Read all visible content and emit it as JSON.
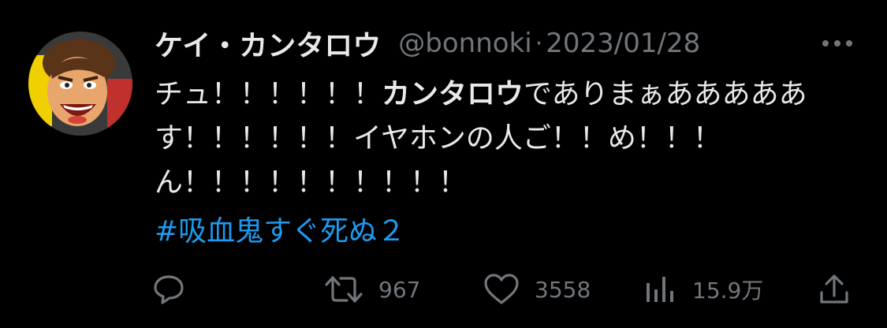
{
  "tweet": {
    "author": {
      "display_name": "ケイ・カンタロウ",
      "handle": "@bonnoki",
      "avatar_icon": "avatar-anime-man"
    },
    "separator": "·",
    "date": "2023/01/28",
    "more_icon": "more-horizontal-icon",
    "body": {
      "line1_a": "チュ！！！！！！",
      "line1_bold": "カンタロウ",
      "line1_b": "でありまぁあああああ",
      "line2": "す！！！！！！イヤホンの人ご！！め！！！",
      "line3": "ん！！！！！！！！！！"
    },
    "hashtag": "#吸血鬼すぐ死ぬ２",
    "actions": {
      "reply": {
        "icon": "reply-icon",
        "count": ""
      },
      "retweet": {
        "icon": "retweet-icon",
        "count": "967"
      },
      "like": {
        "icon": "heart-icon",
        "count": "3558"
      },
      "views": {
        "icon": "views-chart-icon",
        "count": "15.9万"
      },
      "share": {
        "icon": "share-icon",
        "count": ""
      }
    },
    "colors": {
      "background": "#000000",
      "text": "#e7e9ea",
      "secondary": "#71767b",
      "link": "#1d9bf0"
    }
  }
}
